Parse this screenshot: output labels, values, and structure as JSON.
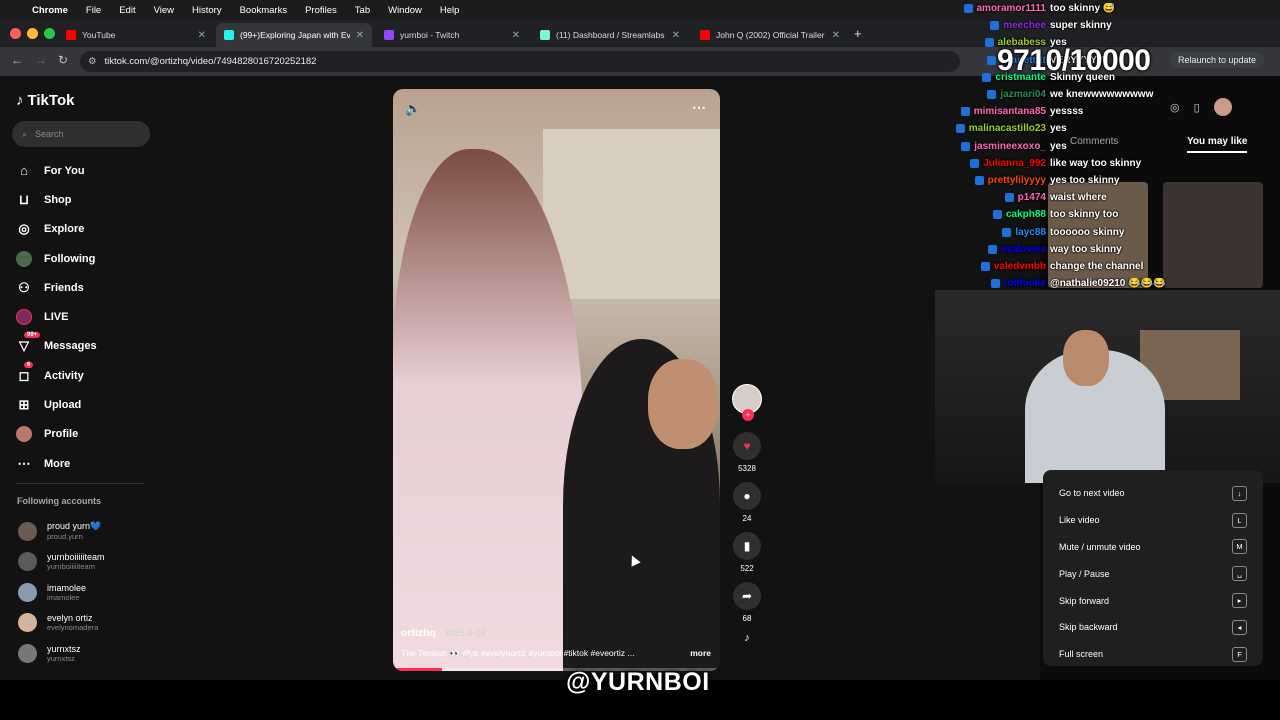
{
  "menubar": {
    "app": "Chrome",
    "items": [
      "File",
      "Edit",
      "View",
      "History",
      "Bookmarks",
      "Profiles",
      "Tab",
      "Window",
      "Help"
    ]
  },
  "tabs": [
    {
      "title": "YouTube",
      "color": "#ff0000"
    },
    {
      "title": "(99+)Exploring Japan with Ev...",
      "color": "#25f4ee"
    },
    {
      "title": "yurnboi - Twitch",
      "color": "#9146ff"
    },
    {
      "title": "(11) Dashboard / Streamlabs",
      "color": "#80f5d2"
    },
    {
      "title": "John Q (2002) Official Trailer",
      "color": "#ff0000"
    }
  ],
  "address": {
    "url": "tiktok.com/@ortizhq/video/7494828016720252182",
    "relaunch": "Relaunch to update"
  },
  "sidebar": {
    "brand": "TikTok",
    "search_placeholder": "Search",
    "items": [
      {
        "label": "For You",
        "icon": "home-icon",
        "glyph": "⌂"
      },
      {
        "label": "Shop",
        "icon": "shop-icon",
        "glyph": "⊔"
      },
      {
        "label": "Explore",
        "icon": "compass-icon",
        "glyph": "◎"
      },
      {
        "label": "Following",
        "icon": "following-icon",
        "glyph": "☺"
      },
      {
        "label": "Friends",
        "icon": "friends-icon",
        "glyph": "⚇"
      },
      {
        "label": "LIVE",
        "icon": "live-icon",
        "glyph": "●"
      },
      {
        "label": "Messages",
        "icon": "messages-icon",
        "glyph": "▽",
        "badge": "99+"
      },
      {
        "label": "Activity",
        "icon": "activity-icon",
        "glyph": "◻",
        "badge": "6"
      },
      {
        "label": "Upload",
        "icon": "upload-icon",
        "glyph": "⊞"
      },
      {
        "label": "Profile",
        "icon": "profile-icon",
        "glyph": "●"
      },
      {
        "label": "More",
        "icon": "more-icon",
        "glyph": "⋯"
      }
    ],
    "following_title": "Following accounts",
    "following": [
      {
        "name": "proud yurn💙",
        "handle": "proud.yurn"
      },
      {
        "name": "yurnboiiiiiteam",
        "handle": "yurnboiiiiiteam"
      },
      {
        "name": "imamolee",
        "handle": "imamolee"
      },
      {
        "name": "evelyn ortiz",
        "handle": "evelynomadera"
      },
      {
        "name": "yurnxtsz",
        "handle": "yurnxtsz"
      }
    ]
  },
  "video": {
    "author": "ortizhq",
    "date": "· 2025-4-18",
    "description": "The Tension 👀 #fyp #evelynortiz #yurnboi #tiktok #eveortiz ...",
    "more": "more",
    "progress": 0.15
  },
  "actions": {
    "likes": "5328",
    "comments": "24",
    "saves": "522",
    "shares": "68"
  },
  "chat": [
    {
      "user": "amoramor1111",
      "msg": "too skinny 😅",
      "color": "#ff69b4"
    },
    {
      "user": "meechee",
      "msg": "super skinny",
      "color": "#8a2be2"
    },
    {
      "user": "alebabess",
      "msg": "yes",
      "color": "#9acd32"
    },
    {
      "user": "scarlettttt",
      "msg": "VERYYYYY",
      "color": "#1e90ff"
    },
    {
      "user": "cristmante",
      "msg": "Skinny queen",
      "color": "#00ff7f"
    },
    {
      "user": "jazmari04",
      "msg": "we knewwwwwwwww",
      "color": "#2e8b57"
    },
    {
      "user": "mimisantana85",
      "msg": "yessss",
      "color": "#ff69b4"
    },
    {
      "user": "malinacastillo23",
      "msg": "yes",
      "color": "#9acd32"
    },
    {
      "user": "jasmineexoxo_",
      "msg": "yes",
      "color": "#ff69b4"
    },
    {
      "user": "Julianna_992",
      "msg": "like way too skinny",
      "color": "#ff0000"
    },
    {
      "user": "prettylilyyyy",
      "msg": "yes too skinny",
      "color": "#ff4500"
    },
    {
      "user": "p1474",
      "msg": "waist where",
      "color": "#ff69b4"
    },
    {
      "user": "cakph88",
      "msg": "too skinny too",
      "color": "#00ff7f"
    },
    {
      "user": "layc88",
      "msg": "toooooo skinny",
      "color": "#1e90ff"
    },
    {
      "user": "evalovies",
      "msg": "way too skinny",
      "color": "#0000ff"
    },
    {
      "user": "valedvmbb",
      "msg": "change the channel",
      "color": "#ff0000"
    },
    {
      "user": "rollfoolie",
      "msg": "@nathalie09210 😂😂😂",
      "color": "#0000ff"
    }
  ],
  "counter": "9710/10000",
  "right_panel": {
    "comments_tab": "Comments",
    "you_may_like_tab": "You may like"
  },
  "shortcuts": [
    {
      "label": "Go to next video",
      "key": "↓"
    },
    {
      "label": "Like video",
      "key": "L"
    },
    {
      "label": "Mute / unmute video",
      "key": "M"
    },
    {
      "label": "Play / Pause",
      "key": "␣"
    },
    {
      "label": "Skip forward",
      "key": "▸"
    },
    {
      "label": "Skip backward",
      "key": "◂"
    },
    {
      "label": "Full screen",
      "key": "F"
    }
  ],
  "watermark": "@YURNBOI"
}
